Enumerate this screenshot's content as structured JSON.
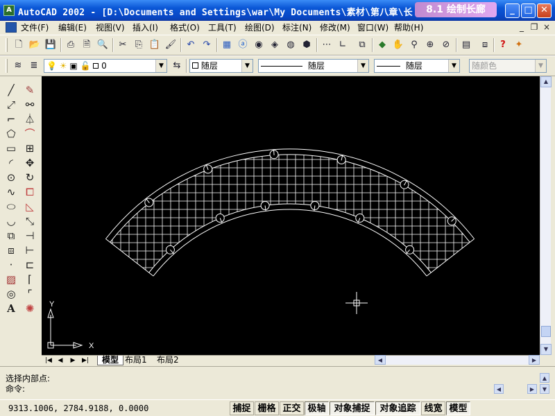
{
  "window": {
    "title": "AutoCAD 2002 - [D:\\Documents and Settings\\war\\My Documents\\素材\\第八章\\长",
    "caption_badge": "8.1 绘制长廊",
    "minimize": "_",
    "maximize": "□",
    "close": "✕"
  },
  "menu": {
    "items": [
      "文件(F)",
      "编辑(E)",
      "视图(V)",
      "插入(I)",
      "格式(O)",
      "工具(T)",
      "绘图(D)",
      "标注(N)",
      "修改(M)",
      "窗口(W)",
      "帮助(H)"
    ],
    "doc_minimize": "_",
    "doc_restore": "❐",
    "doc_close": "×"
  },
  "standard_toolbar": {
    "icons": [
      "new-icon",
      "open-icon",
      "save-icon",
      "print-icon",
      "print-preview-icon",
      "publish-icon",
      "cut-icon",
      "copy-icon",
      "paste-icon",
      "match-properties-icon",
      "undo-icon",
      "redo-icon",
      "launch-icon",
      "autocad-today-icon",
      "design-center-icon",
      "properties-icon",
      "tool-palette-icon",
      "dbconnect-icon",
      "distance-icon",
      "ucs-icon",
      "named-views-icon",
      "3d-orbit-icon",
      "realtime-pan-icon",
      "zoom-realtime-icon",
      "zoom-window-icon",
      "zoom-previous-icon",
      "aerial-view-icon",
      "help-icon",
      "extra-icon"
    ]
  },
  "properties_toolbar": {
    "layer_value": "0",
    "color_value": "随层",
    "linetype_value": "随层",
    "lineweight_value": "随层",
    "plotstyle_value": "随颜色"
  },
  "draw_tools": [
    "line-icon",
    "construction-line-icon",
    "polyline-icon",
    "polygon-icon",
    "rectangle-icon",
    "arc-icon",
    "circle-icon",
    "spline-icon",
    "ellipse-icon",
    "ellipse-arc-icon",
    "insert-block-icon",
    "make-block-icon",
    "point-icon",
    "hatch-icon",
    "region-icon",
    "multiline-text-icon"
  ],
  "modify_tools": [
    "erase-icon",
    "copy-object-icon",
    "mirror-icon",
    "offset-icon",
    "array-icon",
    "move-icon",
    "rotate-icon",
    "scale-icon",
    "stretch-icon",
    "lengthen-icon",
    "trim-icon",
    "extend-icon",
    "break-icon",
    "chamfer-icon",
    "fillet-icon",
    "explode-icon"
  ],
  "drawing": {
    "ucs_x_label": "X",
    "ucs_y_label": "Y",
    "line_color": "#ffffff",
    "background_color": "#000000"
  },
  "layout_tabs": [
    "模型",
    "布局1",
    "布局2"
  ],
  "active_tab": "模型",
  "command": {
    "history": "选择内部点:",
    "prompt": "命令:",
    "input_value": ""
  },
  "status": {
    "coordinates": "9313.1006, 2784.9188, 0.0000",
    "toggles": [
      "捕捉",
      "栅格",
      "正交",
      "极轴",
      "对象捕捉",
      "对象追踪",
      "线宽",
      "模型"
    ],
    "pressed": [
      "极轴",
      "对象捕捉",
      "对象追踪",
      "模型"
    ]
  }
}
